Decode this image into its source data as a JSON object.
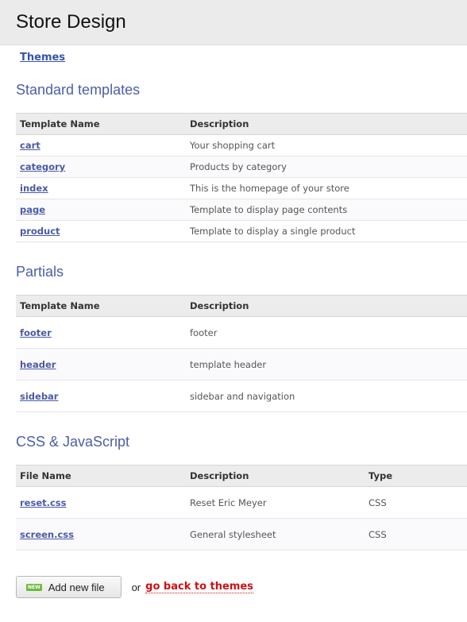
{
  "page": {
    "title": "Store Design"
  },
  "nav": {
    "themes_link": "Themes"
  },
  "standard": {
    "title": "Standard templates",
    "headers": [
      "Template Name",
      "Description"
    ],
    "rows": [
      {
        "name": "cart",
        "description": "Your shopping cart"
      },
      {
        "name": "category",
        "description": "Products by category"
      },
      {
        "name": "index",
        "description": "This is the homepage of your store"
      },
      {
        "name": "page",
        "description": "Template to display page contents"
      },
      {
        "name": "product",
        "description": "Template to display a single product"
      }
    ]
  },
  "partials": {
    "title": "Partials",
    "headers": [
      "Template Name",
      "Description"
    ],
    "rows": [
      {
        "name": "footer",
        "description": "footer"
      },
      {
        "name": "header",
        "description": "template header"
      },
      {
        "name": "sidebar",
        "description": "sidebar and navigation"
      }
    ]
  },
  "assets": {
    "title": "CSS & JavaScript",
    "headers": [
      "File Name",
      "Description",
      "Type"
    ],
    "rows": [
      {
        "name": "reset.css",
        "description": "Reset Eric Meyer",
        "type": "CSS"
      },
      {
        "name": "screen.css",
        "description": "General stylesheet",
        "type": "CSS"
      }
    ]
  },
  "actions": {
    "new_badge": "NEW",
    "add_file_label": "Add new file",
    "or_text": "or",
    "back_link": "go back to themes"
  },
  "colors": {
    "header_bg": "#ebebeb",
    "section_title": "#4c5ea8",
    "link": "#4a5aa8",
    "back_link": "#cc1111",
    "new_badge": "#6dbb3c"
  }
}
